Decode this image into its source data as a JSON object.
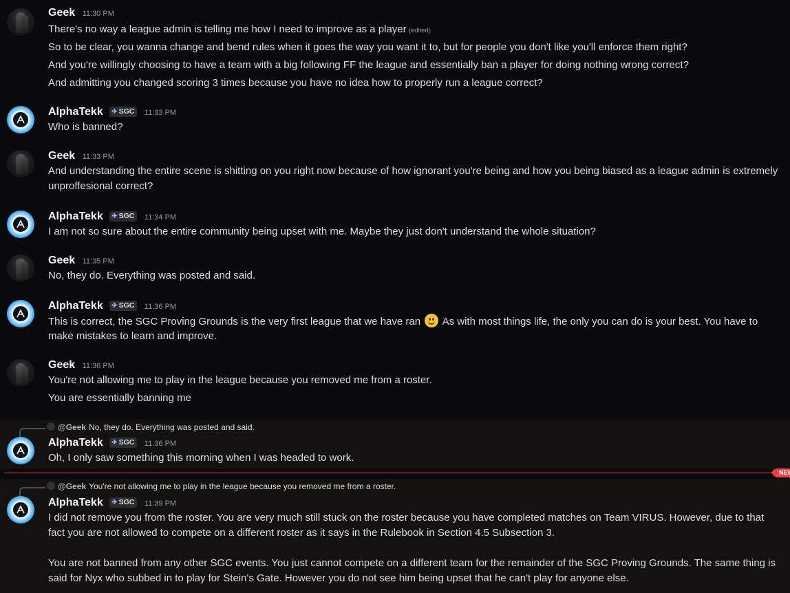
{
  "messages": [
    {
      "user": "Geek",
      "time": "11:30 PM",
      "lines": [
        "There's no way a league admin is telling me how I need to improve as a player",
        "So to be clear, you wanna change and bend rules when it goes the way you want it to, but for people you don't like you'll enforce them right?",
        "And you're willingly choosing to have a team with a big following FF the league and essentially ban a player for doing nothing wrong correct?",
        "And admitting you changed scoring 3 times because you have no idea how to properly run a league correct?"
      ],
      "edited_label": "(edited)"
    },
    {
      "user": "AlphaTekk",
      "tag": "SGC",
      "time": "11:33 PM",
      "lines": [
        "Who is banned?"
      ]
    },
    {
      "user": "Geek",
      "time": "11:33 PM",
      "lines": [
        "And understanding the entire scene is shitting on you right now because of how ignorant you're being and how you being biased as a league admin is extremely",
        "unproffesional correct?"
      ]
    },
    {
      "user": "AlphaTekk",
      "tag": "SGC",
      "time": "11:34 PM",
      "lines": [
        "I am not so sure about the entire community being upset with me. Maybe they just don't understand the whole situation?"
      ]
    },
    {
      "user": "Geek",
      "time": "11:35 PM",
      "lines": [
        "No, they do. Everything was posted and said."
      ]
    },
    {
      "user": "AlphaTekk",
      "tag": "SGC",
      "time": "11:36 PM",
      "lines": [
        "This is correct, the SGC Proving Grounds is the very first league that we have ran",
        "As with most things life, the only you can do is your best. You have to",
        "make mistakes to learn and improve."
      ]
    },
    {
      "user": "Geek",
      "time": "11:36 PM",
      "lines": [
        "You're not allowing me to play in the league because you removed me from a roster.",
        "You are essentially banning me"
      ]
    },
    {
      "reply": {
        "name": "@Geek",
        "text": "No, they do. Everything was posted and said."
      },
      "user": "AlphaTekk",
      "tag": "SGC",
      "time": "11:36 PM",
      "lines": [
        "Oh, I only saw something this morning when I was headed to work."
      ]
    },
    {
      "reply": {
        "name": "@Geek",
        "text": "You're not allowing me to play in the league because you removed me from a roster."
      },
      "user": "AlphaTekk",
      "tag": "SGC",
      "time": "11:39 PM",
      "lines": [
        "I did not remove you from the roster. You are very much still stuck on the roster because you have completed matches on Team VIRUS. However, due to that",
        "fact you are not allowed to compete on a different roster as it says in the Rulebook in Section 4.5 Subsection 3.",
        "You are not banned from any other SGC events. You just cannot compete on a different team for the remainder of the SGC Proving Grounds. The same thing is",
        "said for Nyx who subbed in to play for Stein's Gate. However you do not see him being upset that he can't play for anyone else."
      ]
    }
  ],
  "new_divider_label": "NEW",
  "colors": {
    "background": "#0a0a0c",
    "highlight": "#141210",
    "divider": "#f23f43"
  }
}
